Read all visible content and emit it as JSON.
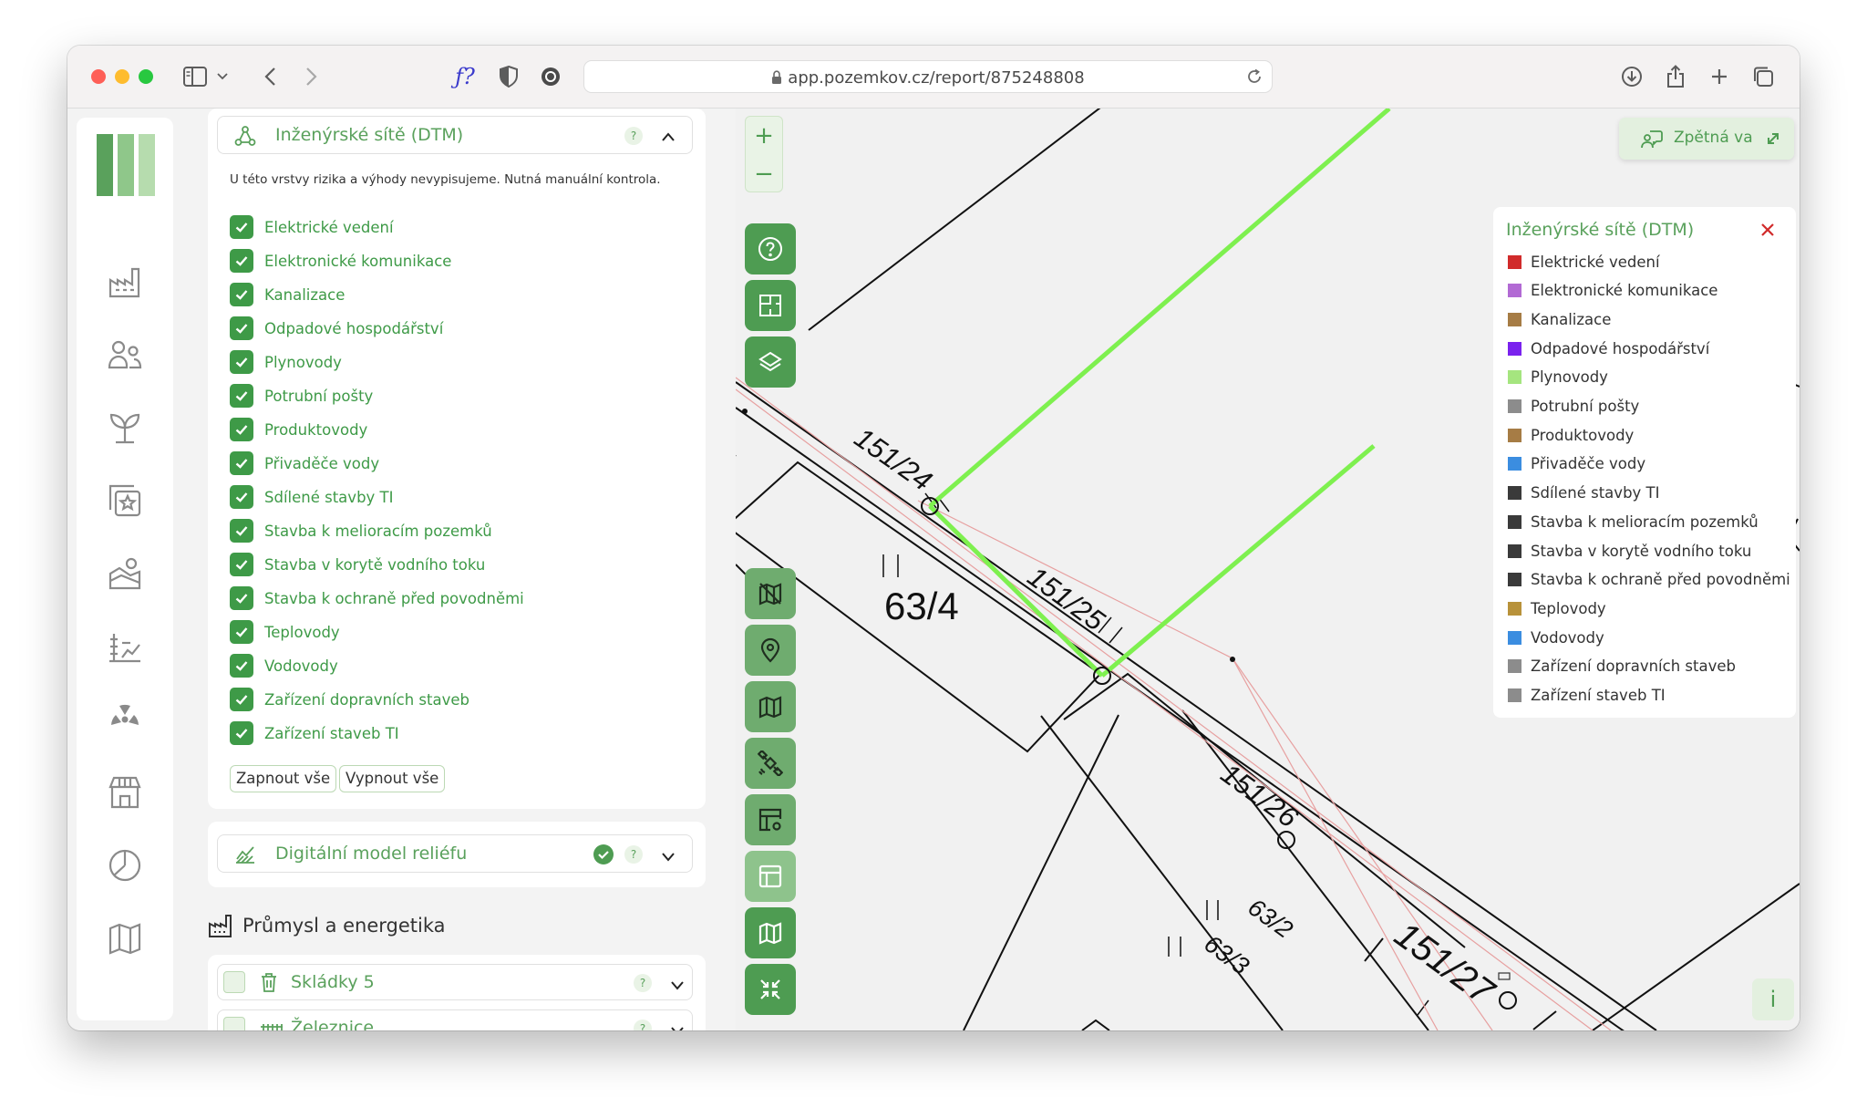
{
  "browser": {
    "url": "app.pozemkov.cz/report/875248808"
  },
  "panel": {
    "section1": {
      "title": "Inženýrské sítě (DTM)",
      "help": "?",
      "note": "U této vrstvy rizika a výhody nevypisujeme. Nutná manuální kontrola.",
      "items": [
        {
          "label": "Elektrické vedení",
          "checked": true
        },
        {
          "label": "Elektronické komunikace",
          "checked": true
        },
        {
          "label": "Kanalizace",
          "checked": true
        },
        {
          "label": "Odpadové hospodářství",
          "checked": true
        },
        {
          "label": "Plynovody",
          "checked": true
        },
        {
          "label": "Potrubní pošty",
          "checked": true
        },
        {
          "label": "Produktovody",
          "checked": true
        },
        {
          "label": "Přivaděče vody",
          "checked": true
        },
        {
          "label": "Sdílené stavby TI",
          "checked": true
        },
        {
          "label": "Stavba k melioracím pozemků",
          "checked": true
        },
        {
          "label": "Stavba v korytě vodního toku",
          "checked": true
        },
        {
          "label": "Stavba k ochraně před povodněmi",
          "checked": true
        },
        {
          "label": "Teplovody",
          "checked": true
        },
        {
          "label": "Vodovody",
          "checked": true
        },
        {
          "label": "Zařízení dopravních staveb",
          "checked": true
        },
        {
          "label": "Zařízení staveb TI",
          "checked": true
        }
      ],
      "enable_all": "Zapnout vše",
      "disable_all": "Vypnout vše"
    },
    "section2": {
      "title": "Digitální model reliéfu",
      "help": "?"
    },
    "category": {
      "title": "Průmysl a energetika"
    },
    "section3": {
      "title": "Skládky 5",
      "help": "?"
    },
    "section4": {
      "title": "Železnice",
      "help": "?"
    }
  },
  "map": {
    "zoom_in": "+",
    "zoom_out": "−",
    "feedback_label": "Zpětná vazba",
    "info_label": "i",
    "parcel_labels": [
      "151/24",
      "151/25",
      "151/26",
      "151/27",
      "63/4",
      "63/2",
      "63/3"
    ],
    "legend": {
      "title": "Inženýrské sítě (DTM)",
      "items": [
        {
          "label": "Elektrické vedení",
          "color": "#d12b2b"
        },
        {
          "label": "Elektronické komunikace",
          "color": "#b26ad4"
        },
        {
          "label": "Kanalizace",
          "color": "#a67c45"
        },
        {
          "label": "Odpadové hospodářství",
          "color": "#7a22ee"
        },
        {
          "label": "Plynovody",
          "color": "#a5e57f"
        },
        {
          "label": "Potrubní pošty",
          "color": "#8c8c8c"
        },
        {
          "label": "Produktovody",
          "color": "#a67c45"
        },
        {
          "label": "Přivaděče vody",
          "color": "#3b8de0"
        },
        {
          "label": "Sdílené stavby TI",
          "color": "#3a3a3a"
        },
        {
          "label": "Stavba k melioracím pozemků",
          "color": "#3a3a3a"
        },
        {
          "label": "Stavba v korytě vodního toku",
          "color": "#3a3a3a"
        },
        {
          "label": "Stavba k ochraně před povodněmi",
          "color": "#3a3a3a"
        },
        {
          "label": "Teplovody",
          "color": "#b8923a"
        },
        {
          "label": "Vodovody",
          "color": "#3b8de0"
        },
        {
          "label": "Zařízení dopravních staveb",
          "color": "#8c8c8c"
        },
        {
          "label": "Zařízení staveb TI",
          "color": "#8c8c8c"
        }
      ]
    }
  },
  "colors": {
    "accent": "#4e9c52",
    "pipe": "#7ef04f"
  }
}
